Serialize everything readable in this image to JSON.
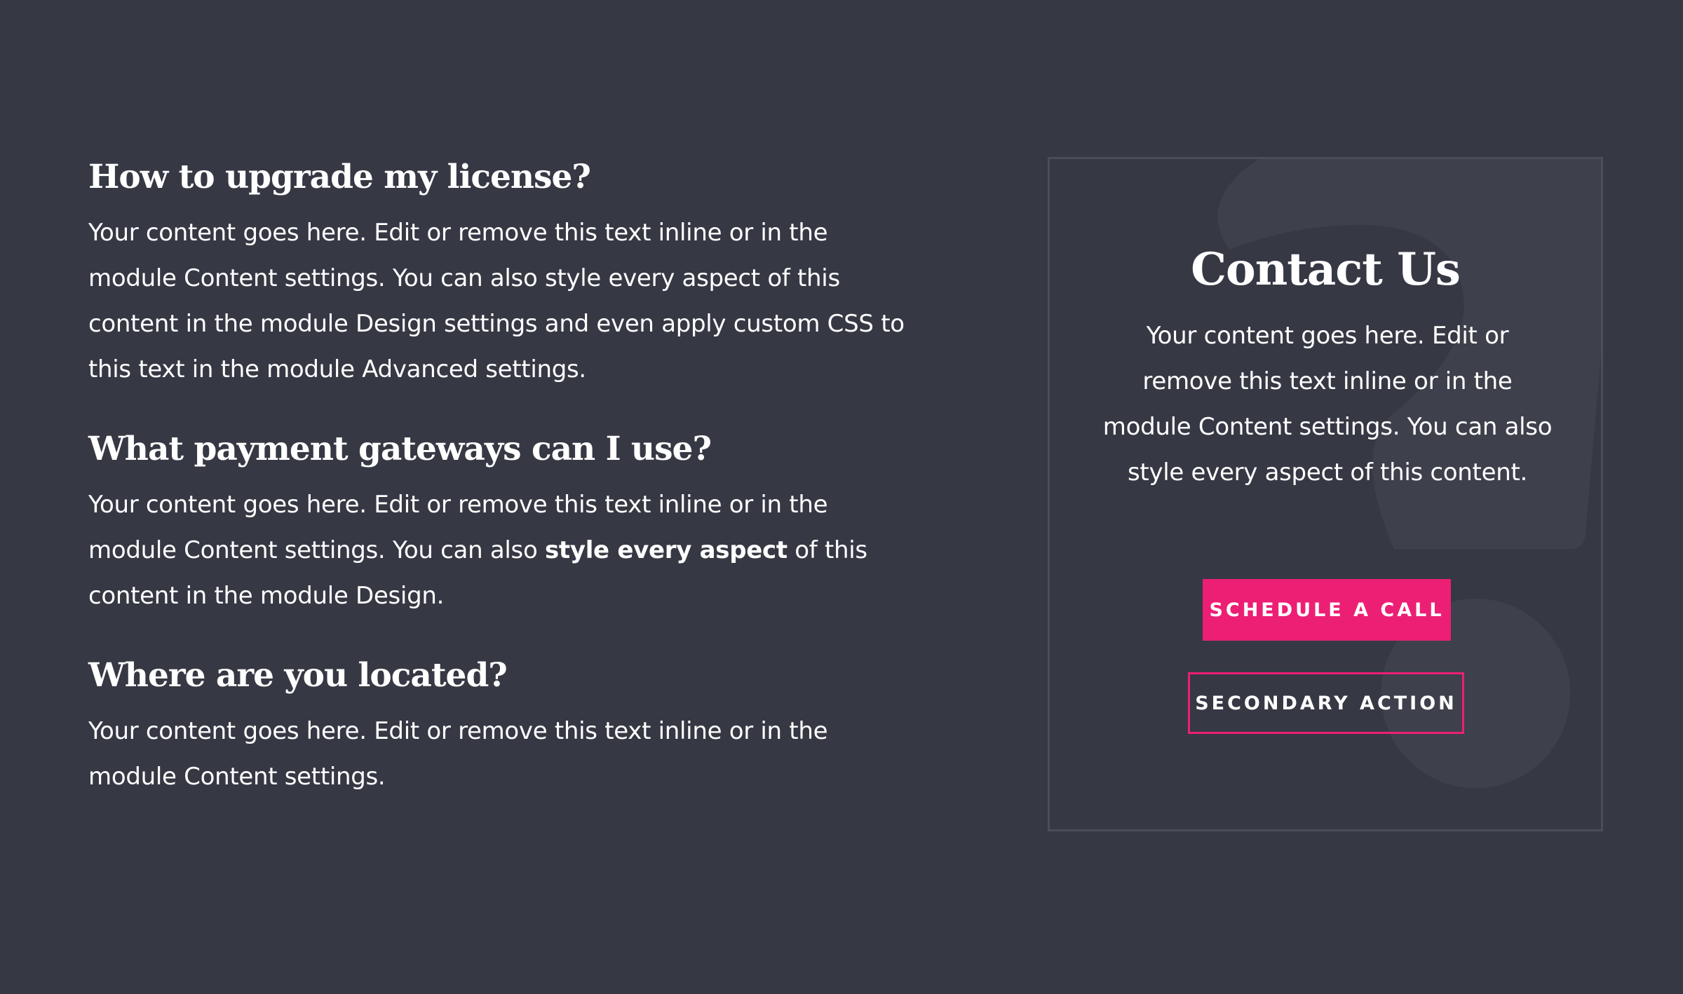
{
  "faq": {
    "items": [
      {
        "title": "How to upgrade my license?",
        "body": "Your content goes here. Edit or remove this text inline or in the module Content settings. You can also style every aspect of this content in the module Design settings and even apply custom CSS to this text in the module Advanced settings."
      },
      {
        "title": "What payment gateways can I use?",
        "body_before": "Your content goes here. Edit or remove this text inline or in the module Content settings. You can also ",
        "body_bold": "style every aspect",
        "body_after": " of this content in the module Design."
      },
      {
        "title": "Where are you located?",
        "body": "Your content goes here. Edit or remove this text inline or in the module Content settings."
      }
    ]
  },
  "contact": {
    "title": "Contact Us",
    "text": "Your content goes here. Edit or remove this text inline or in the module Content settings. You can also style every aspect of this content.",
    "primary_button": "SCHEDULE A CALL",
    "secondary_button": "SECONDARY ACTION",
    "background_icon": "question-mark-icon"
  },
  "colors": {
    "background": "#363844",
    "accent": "#ec1f74",
    "card_border": "#4b4d59",
    "watermark": "#3e404c",
    "text": "#ffffff"
  }
}
